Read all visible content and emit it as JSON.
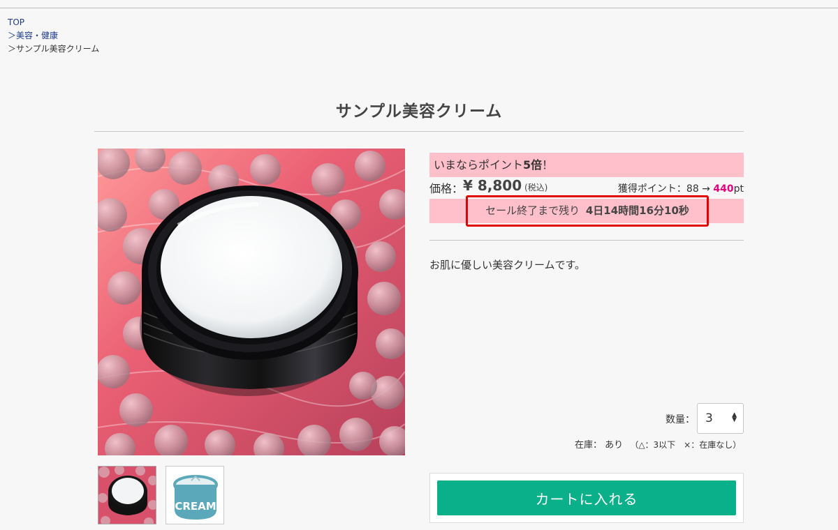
{
  "breadcrumb": {
    "top": "TOP",
    "category": "＞美容・健康",
    "current": "＞サンプル美容クリーム"
  },
  "product": {
    "title": "サンプル美容クリーム",
    "description": "お肌に優しい美容クリームです。"
  },
  "promo": {
    "prefix": "いまならポイント",
    "multiplier": "5倍",
    "suffix": "！"
  },
  "price": {
    "label": "価格：",
    "value": "¥ 8,800",
    "tax_note": "(税込)"
  },
  "points": {
    "label": "獲得ポイント：88 →",
    "new_value": "440",
    "unit": "pt"
  },
  "sale": {
    "label": "セール終了まで残り",
    "countdown": "4日14時間16分10秒"
  },
  "quantity": {
    "label": "数量：",
    "selected": "3"
  },
  "stock": {
    "label": "在庫：",
    "status": "あり",
    "legend": "（△：3以下　×：在庫なし）"
  },
  "cart": {
    "button_label": "カートに入れる"
  },
  "thumbnail_text": {
    "cream_label": "CREAM"
  },
  "colors": {
    "promo_bg": "#ffc0cb",
    "points_accent": "#e6007e",
    "sale_border": "#e00000",
    "cart_button": "#0ab089"
  }
}
